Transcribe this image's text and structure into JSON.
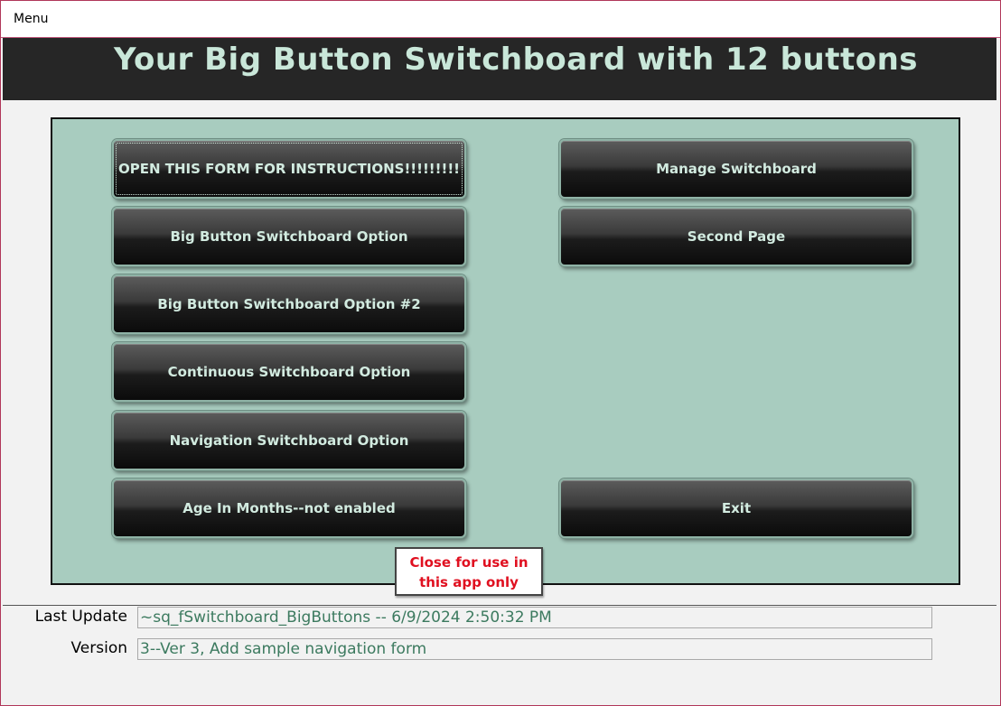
{
  "tab": {
    "label": "Menu"
  },
  "header": {
    "title": "Your Big Button Switchboard with 12 buttons"
  },
  "buttons_left": [
    "OPEN THIS FORM FOR INSTRUCTIONS!!!!!!!!!",
    "Big Button Switchboard Option",
    "Big Button Switchboard Option #2",
    "Continuous Switchboard Option",
    "Navigation Switchboard Option",
    "Age In Months--not enabled"
  ],
  "buttons_right": {
    "manage": "Manage Switchboard",
    "second_page": "Second Page",
    "exit": "Exit"
  },
  "close_note": "Close for use in this app only",
  "footer": {
    "last_update_label": "Last Update",
    "last_update_value": "~sq_fSwitchboard_BigButtons -- 6/9/2024 2:50:32 PM",
    "version_label": "Version",
    "version_value": "3--Ver 3, Add sample navigation form"
  },
  "colors": {
    "header_bg": "#262626",
    "title_text": "#c9e7d9",
    "panel_bg": "#a8ccbf",
    "note_text": "#e01020",
    "field_text": "#3c7a5f"
  }
}
